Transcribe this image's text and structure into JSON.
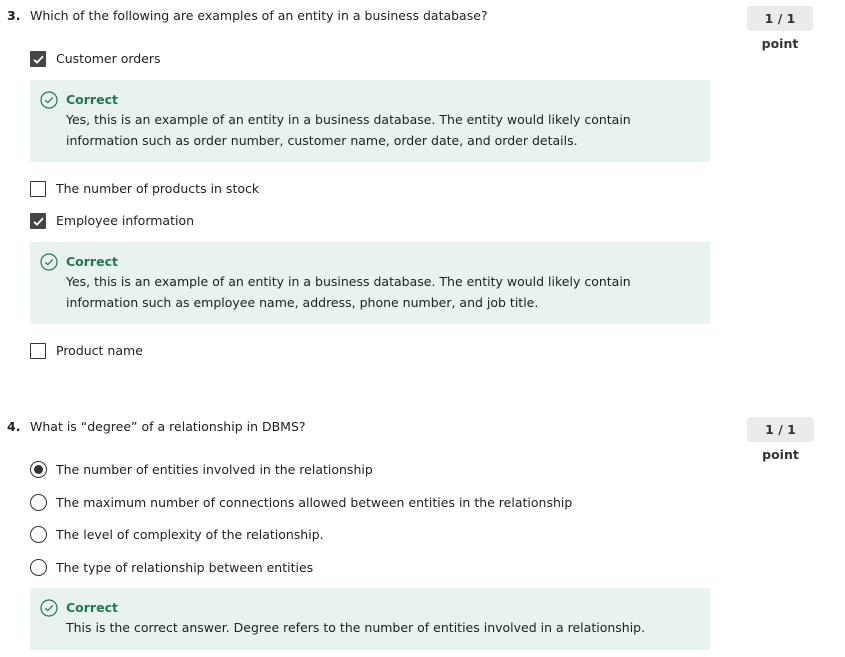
{
  "questions": [
    {
      "number": "3.",
      "text": "Which of the following are examples of an entity in a business database?",
      "score": "1 / 1 point",
      "type": "checkbox",
      "options": [
        {
          "label": "Customer orders",
          "checked": true,
          "feedback": {
            "title": "Correct",
            "text": "Yes, this is an example of an entity in a business database. The entity would likely contain information such as order number, customer name, order date, and order details."
          }
        },
        {
          "label": "The number of products in stock",
          "checked": false
        },
        {
          "label": "Employee information",
          "checked": true,
          "feedback": {
            "title": "Correct",
            "text": "Yes, this is an example of an entity in a business database. The entity would likely contain information such as employee name, address, phone number, and job title."
          }
        },
        {
          "label": "Product name",
          "checked": false
        }
      ]
    },
    {
      "number": "4.",
      "text": "What is “degree” of a relationship in DBMS?",
      "score": "1 / 1 point",
      "type": "radio",
      "options": [
        {
          "label": "The number of entities involved in the relationship",
          "checked": true
        },
        {
          "label": "The maximum number of connections allowed between entities in the relationship",
          "checked": false
        },
        {
          "label": "The level of complexity of the relationship.",
          "checked": false
        },
        {
          "label": "The type of relationship between entities",
          "checked": false
        }
      ],
      "feedback": {
        "title": "Correct",
        "text": "This is the correct answer. Degree refers to the number of entities involved in a relationship."
      }
    }
  ],
  "colors": {
    "correct_green": "#1e7a4f",
    "feedback_bg": "#e8f2ee",
    "score_badge_bg": "#ebebeb",
    "checked_fill": "#454545"
  },
  "icons": {
    "feedback": "check-circle-icon",
    "checkbox_checked": "checkmark-icon"
  }
}
